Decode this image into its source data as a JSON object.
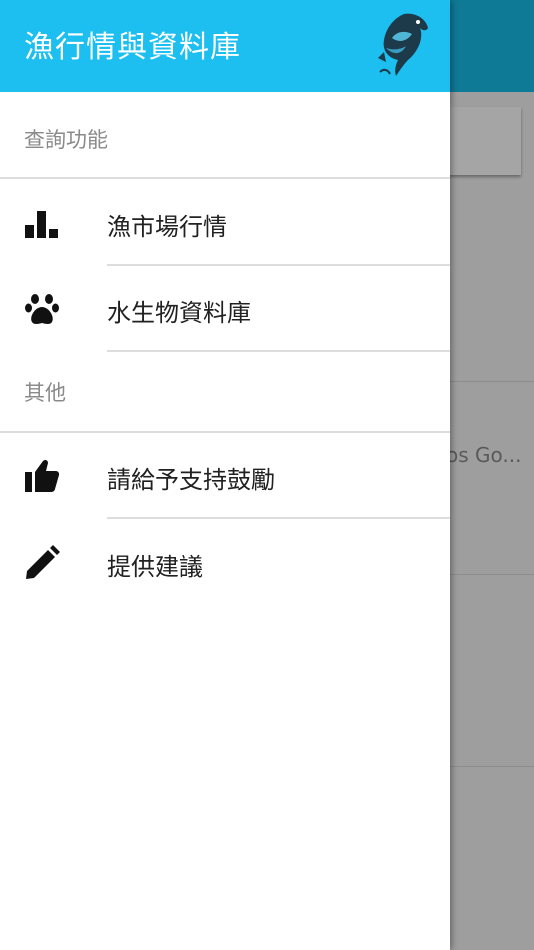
{
  "drawer": {
    "title": "漁行情與資料庫",
    "sections": [
      {
        "header": "查詢功能",
        "items": [
          {
            "label": "漁市場行情",
            "icon": "bar-chart-icon"
          },
          {
            "label": "水生物資料庫",
            "icon": "paw-icon"
          }
        ]
      },
      {
        "header": "其他",
        "items": [
          {
            "label": "請給予支持鼓勵",
            "icon": "thumbs-up-icon"
          },
          {
            "label": "提供建議",
            "icon": "pencil-icon"
          }
        ]
      }
    ]
  },
  "background": {
    "snippet": "os Go..."
  },
  "colors": {
    "header": "#1cbff0",
    "background_appbar": "#0f7a96",
    "scrim": "#9e9e9e"
  }
}
